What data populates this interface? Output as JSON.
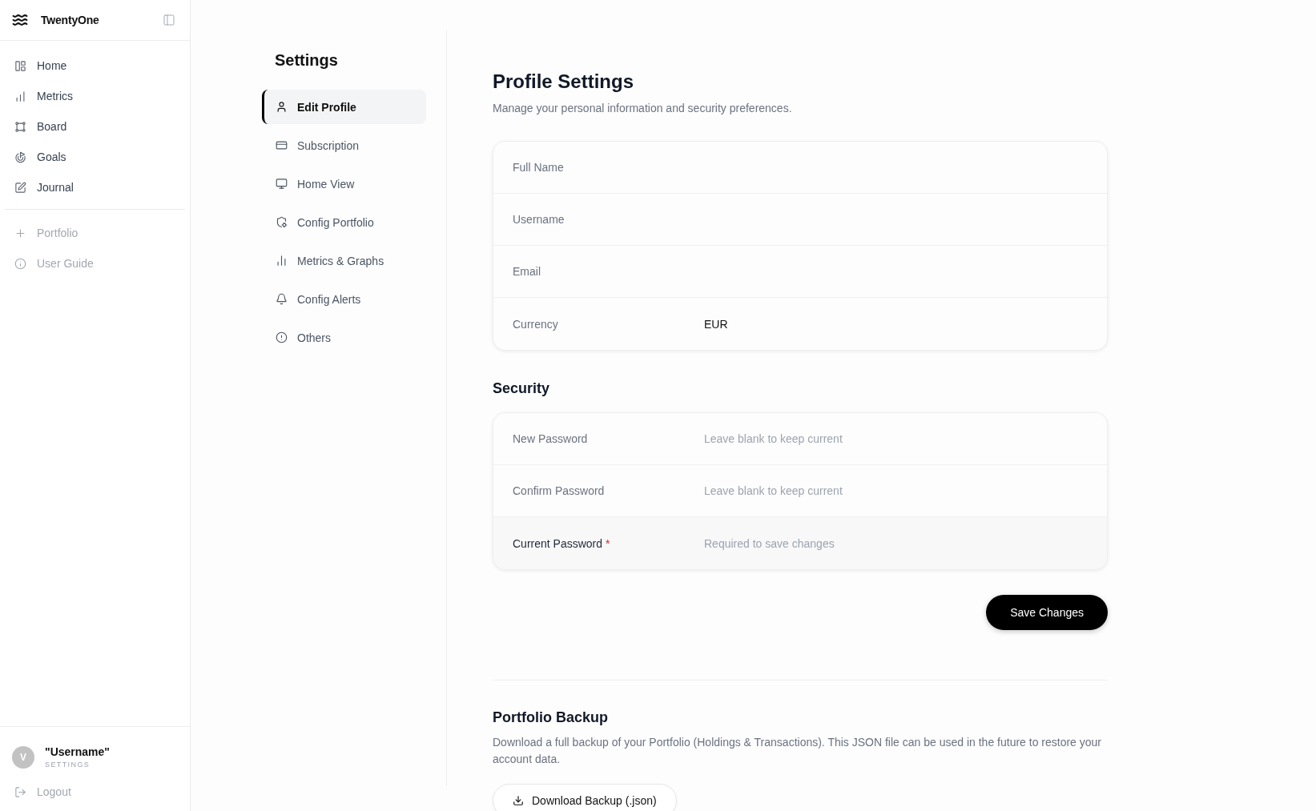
{
  "sidebar": {
    "brand": "TwentyOne",
    "items": [
      {
        "label": "Home",
        "selected": false
      },
      {
        "label": "Metrics",
        "selected": false
      },
      {
        "label": "Board",
        "selected": false
      },
      {
        "label": "Goals",
        "selected": false
      },
      {
        "label": "Journal",
        "selected": false
      }
    ],
    "secondary_items": [
      {
        "label": "Portfolio"
      },
      {
        "label": "User Guide"
      }
    ],
    "user": {
      "initial": "V",
      "name": "\"Username\"",
      "caption": "SETTINGS"
    },
    "logout": "Logout"
  },
  "settings_nav": {
    "title": "Settings",
    "items": [
      {
        "label": "Edit Profile",
        "selected": true
      },
      {
        "label": "Subscription",
        "selected": false
      },
      {
        "label": "Home View",
        "selected": false
      },
      {
        "label": "Config Portfolio",
        "selected": false
      },
      {
        "label": "Metrics & Graphs",
        "selected": false
      },
      {
        "label": "Config Alerts",
        "selected": false
      },
      {
        "label": "Others",
        "selected": false
      }
    ]
  },
  "profile": {
    "title": "Profile Settings",
    "subtitle": "Manage your personal information and security preferences.",
    "fields": [
      {
        "label": "Full Name",
        "highlighted": false
      },
      {
        "label": "Username",
        "highlighted": false
      },
      {
        "label": "Email",
        "highlighted": false
      },
      {
        "label": "Currency",
        "value": "EUR",
        "highlighted": false
      }
    ]
  },
  "security": {
    "title": "Security",
    "fields": [
      {
        "label": "New Password",
        "placeholder": "Leave blank to keep current",
        "highlighted": false
      },
      {
        "label": "Confirm Password",
        "placeholder": "Leave blank to keep current",
        "highlighted": false
      },
      {
        "label": "Current Password",
        "required_mark": "*",
        "placeholder": "Required to save changes",
        "highlighted": true
      }
    ]
  },
  "save_button": "Save Changes",
  "backup": {
    "title": "Portfolio Backup",
    "description": "Download a full backup of your Portfolio (Holdings & Transactions). This JSON file can be used in the future to restore your account data.",
    "button": "Download Backup (.json)"
  }
}
